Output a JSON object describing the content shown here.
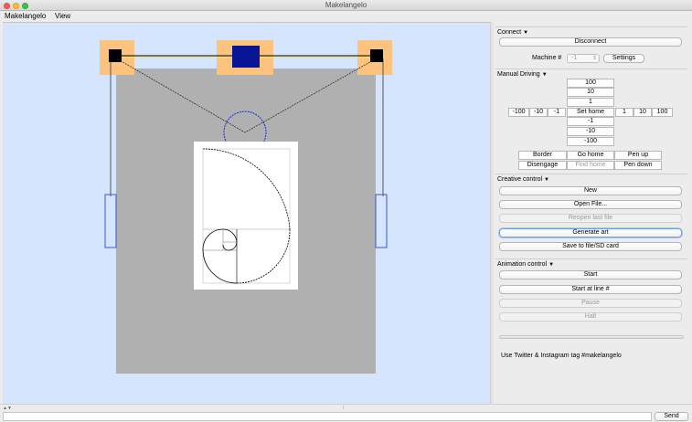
{
  "window": {
    "title": "Makelangelo"
  },
  "menubar": {
    "items": [
      "Makelangelo",
      "View"
    ]
  },
  "connect": {
    "header": "Connect",
    "disconnect_label": "Disconnect",
    "machine_label": "Machine #",
    "machine_value": "-1",
    "settings_label": "Settings"
  },
  "manual": {
    "header": "Manual Driving",
    "up": [
      "100",
      "10",
      "1"
    ],
    "set_home": "Set home",
    "down": [
      "-1",
      "-10",
      "-100"
    ],
    "left": [
      "-100",
      "-10",
      "-1"
    ],
    "right": [
      "1",
      "10",
      "100"
    ],
    "border": "Border",
    "go_home": "Go home",
    "pen_up": "Pen up",
    "disengage": "Disengage",
    "find_home": "Find home",
    "pen_down": "Pen down"
  },
  "creative": {
    "header": "Creative control",
    "new": "New",
    "open_file": "Open File...",
    "reopen": "Reopen last file",
    "generate": "Generate art",
    "save": "Save to file/SD card"
  },
  "animation": {
    "header": "Animation control",
    "start": "Start",
    "start_at_line": "Start at line #",
    "pause": "Pause",
    "halt": "Halt"
  },
  "tagline": "Use Twitter & Instagram tag #makelangelo",
  "bottom": {
    "send_label": "Send"
  },
  "colors": {
    "canvas_bg": "#d4e5fd",
    "machine_board": "#b0b0b0",
    "motor_halo": "#fbc37e",
    "pen_holder": "#0a1496",
    "gondola_circle": "#1a2bd0",
    "counterweight": "#3b56c6"
  }
}
